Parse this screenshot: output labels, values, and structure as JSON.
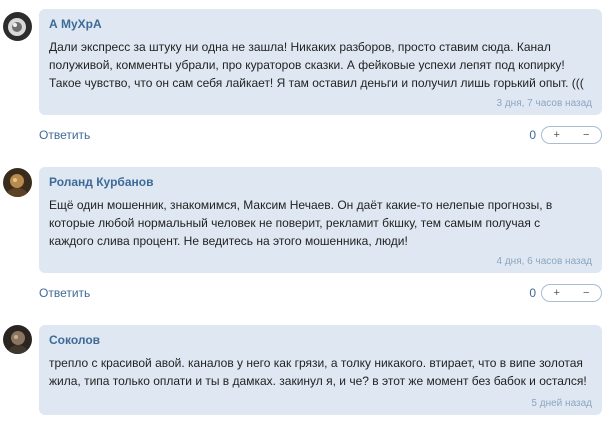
{
  "comments": [
    {
      "author": "А МуХрА",
      "text": "Дали экспресс за штуку ни одна не зашла! Никаких разборов, просто ставим сюда. Канал полуживой, комменты убрали, про кураторов сказки. А фейковые успехи лепят под копирку! Такое чувство, что он сам себя лайкает! Я там оставил деньги и получил лишь горький опыт. (((",
      "time": "3 дня, 7 часов назад",
      "reply": "Ответить",
      "score": "0",
      "plus": "+",
      "minus": "−"
    },
    {
      "author": "Роланд Курбанов",
      "text": "Ещё один мошенник, знакомимся, Максим Нечаев. Он даёт какие-то нелепые прогнозы, в которые любой нормальный человек не поверит, рекламит бкшку, тем самым получая с каждого слива процент. Не ведитесь на этого мошенника, люди!",
      "time": "4 дня, 6 часов назад",
      "reply": "Ответить",
      "score": "0",
      "plus": "+",
      "minus": "−"
    },
    {
      "author": "Соколов",
      "text": "трепло с красивой авой. каналов у него как грязи, а толку никакого. втирает, что в випе золотая жила, типа только оплати и ты в дамках. закинул я, и че? в этот же момент без бабок и остался!",
      "time": "5 дней назад"
    }
  ],
  "colors": {
    "bubble": "#dfe8f2",
    "author": "#3d6a97",
    "time": "#8ca5c0"
  }
}
